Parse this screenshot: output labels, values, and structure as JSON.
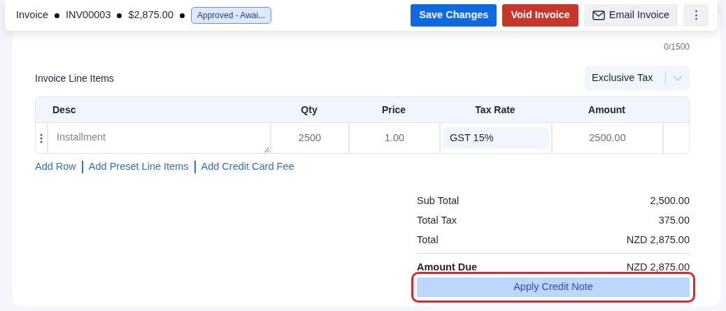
{
  "header": {
    "crumbs": [
      "Invoice",
      "INV00003",
      "$2,875.00"
    ],
    "status_badge": "Approved - Awai...",
    "buttons": [
      {
        "label": "Save Changes",
        "kind": "primary"
      },
      {
        "label": "Void Invoice",
        "kind": "danger"
      },
      {
        "label": "Email Invoice",
        "kind": "email"
      },
      {
        "label": "⋮",
        "kind": "more"
      }
    ]
  },
  "notes_counter": "0/1500",
  "line_items": {
    "title": "Invoice Line Items",
    "tax_mode": "Exclusive Tax",
    "columns": [
      "Desc",
      "Qty",
      "Price",
      "Tax Rate",
      "Amount"
    ],
    "rows": [
      {
        "desc_placeholder": "Installment",
        "qty": "2500",
        "price": "1.00",
        "tax_rate": "GST 15%",
        "amount": "2500.00"
      }
    ],
    "links": [
      "Add Row",
      "Add Preset Line Items",
      "Add Credit Card Fee"
    ]
  },
  "totals": [
    {
      "label": "Sub Total",
      "value": "2,500.00",
      "kind": "plain"
    },
    {
      "label": "Total Tax",
      "value": "375.00",
      "kind": "plain"
    },
    {
      "label": "Total",
      "value": "NZD 2,875.00",
      "kind": "plain"
    },
    {
      "label": "Amount Due",
      "value": "NZD 2,875.00",
      "kind": "due"
    }
  ],
  "apply_button": {
    "label": "Apply Credit Note",
    "highlighted": true
  }
}
